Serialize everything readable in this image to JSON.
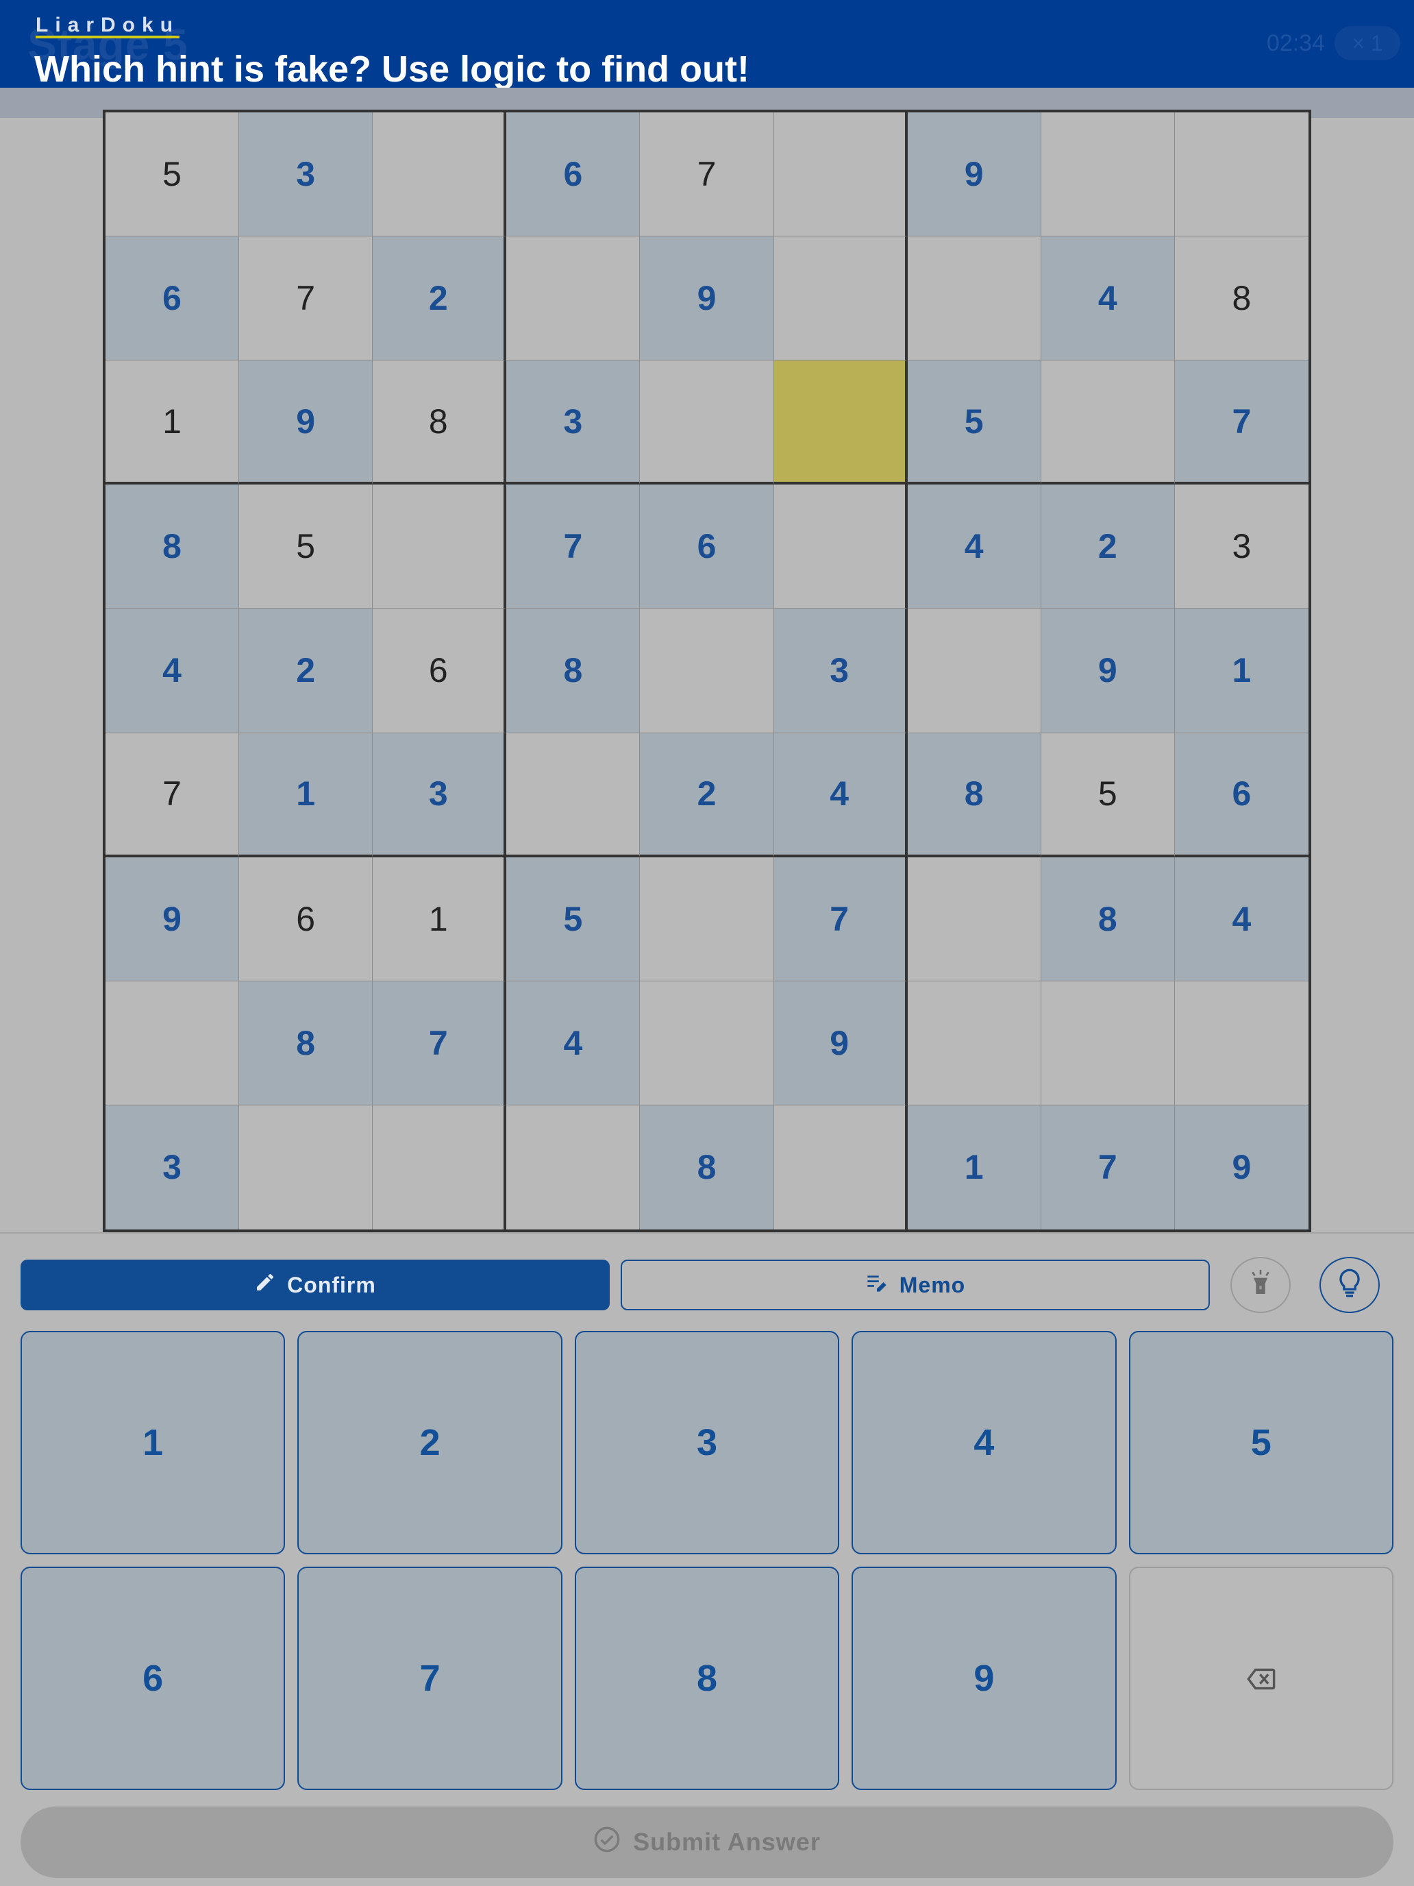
{
  "header": {
    "stage_ghost": "Stage 5",
    "brand": "LiarDoku",
    "headline": "Which hint is fake? Use logic to find out!",
    "timer": "02:34",
    "lives": "× 1"
  },
  "board": {
    "selected": [
      2,
      5
    ],
    "cells": [
      [
        {
          "v": "5",
          "g": false
        },
        {
          "v": "3",
          "g": true
        },
        {
          "v": "",
          "g": false
        },
        {
          "v": "6",
          "g": true
        },
        {
          "v": "7",
          "g": false
        },
        {
          "v": "",
          "g": false
        },
        {
          "v": "9",
          "g": true
        },
        {
          "v": "",
          "g": false
        },
        {
          "v": "",
          "g": false
        }
      ],
      [
        {
          "v": "6",
          "g": true
        },
        {
          "v": "7",
          "g": false
        },
        {
          "v": "2",
          "g": true
        },
        {
          "v": "",
          "g": false
        },
        {
          "v": "9",
          "g": true
        },
        {
          "v": "",
          "g": false
        },
        {
          "v": "",
          "g": false
        },
        {
          "v": "4",
          "g": true
        },
        {
          "v": "8",
          "g": false
        }
      ],
      [
        {
          "v": "1",
          "g": false
        },
        {
          "v": "9",
          "g": true
        },
        {
          "v": "8",
          "g": false
        },
        {
          "v": "3",
          "g": true
        },
        {
          "v": "",
          "g": false
        },
        {
          "v": "",
          "g": false
        },
        {
          "v": "5",
          "g": true
        },
        {
          "v": "",
          "g": false
        },
        {
          "v": "7",
          "g": true
        }
      ],
      [
        {
          "v": "8",
          "g": true
        },
        {
          "v": "5",
          "g": false
        },
        {
          "v": "",
          "g": false
        },
        {
          "v": "7",
          "g": true
        },
        {
          "v": "6",
          "g": true
        },
        {
          "v": "",
          "g": false
        },
        {
          "v": "4",
          "g": true
        },
        {
          "v": "2",
          "g": true
        },
        {
          "v": "3",
          "g": false
        }
      ],
      [
        {
          "v": "4",
          "g": true
        },
        {
          "v": "2",
          "g": true
        },
        {
          "v": "6",
          "g": false
        },
        {
          "v": "8",
          "g": true
        },
        {
          "v": "",
          "g": false
        },
        {
          "v": "3",
          "g": true
        },
        {
          "v": "",
          "g": false
        },
        {
          "v": "9",
          "g": true
        },
        {
          "v": "1",
          "g": true
        }
      ],
      [
        {
          "v": "7",
          "g": false
        },
        {
          "v": "1",
          "g": true
        },
        {
          "v": "3",
          "g": true
        },
        {
          "v": "",
          "g": false
        },
        {
          "v": "2",
          "g": true
        },
        {
          "v": "4",
          "g": true
        },
        {
          "v": "8",
          "g": true
        },
        {
          "v": "5",
          "g": false
        },
        {
          "v": "6",
          "g": true
        }
      ],
      [
        {
          "v": "9",
          "g": true
        },
        {
          "v": "6",
          "g": false
        },
        {
          "v": "1",
          "g": false
        },
        {
          "v": "5",
          "g": true
        },
        {
          "v": "",
          "g": false
        },
        {
          "v": "7",
          "g": true
        },
        {
          "v": "",
          "g": false
        },
        {
          "v": "8",
          "g": true
        },
        {
          "v": "4",
          "g": true
        }
      ],
      [
        {
          "v": "",
          "g": false
        },
        {
          "v": "8",
          "g": true
        },
        {
          "v": "7",
          "g": true
        },
        {
          "v": "4",
          "g": true
        },
        {
          "v": "",
          "g": false
        },
        {
          "v": "9",
          "g": true
        },
        {
          "v": "",
          "g": false
        },
        {
          "v": "",
          "g": false
        },
        {
          "v": "",
          "g": false
        }
      ],
      [
        {
          "v": "3",
          "g": true
        },
        {
          "v": "",
          "g": false
        },
        {
          "v": "",
          "g": false
        },
        {
          "v": "",
          "g": false
        },
        {
          "v": "8",
          "g": true
        },
        {
          "v": "",
          "g": false
        },
        {
          "v": "1",
          "g": true
        },
        {
          "v": "7",
          "g": true
        },
        {
          "v": "9",
          "g": true
        }
      ]
    ]
  },
  "controls": {
    "confirm_label": "Confirm",
    "memo_label": "Memo",
    "confirm_icon": "pencil-icon",
    "memo_icon": "notes-edit-icon",
    "flashlight_icon": "flashlight-icon",
    "hint_icon": "lightbulb-icon"
  },
  "keypad": {
    "keys": [
      "1",
      "2",
      "3",
      "4",
      "5",
      "6",
      "7",
      "8",
      "9"
    ],
    "erase_icon": "backspace-icon"
  },
  "submit": {
    "label": "Submit Answer",
    "icon": "check-circle-icon"
  },
  "colors": {
    "header_bg": "#003c91",
    "accent_blue": "#114b92",
    "given_cell": "#a2adb6",
    "selected_cell": "#b9b055",
    "underline_yellow": "#f4e300"
  }
}
